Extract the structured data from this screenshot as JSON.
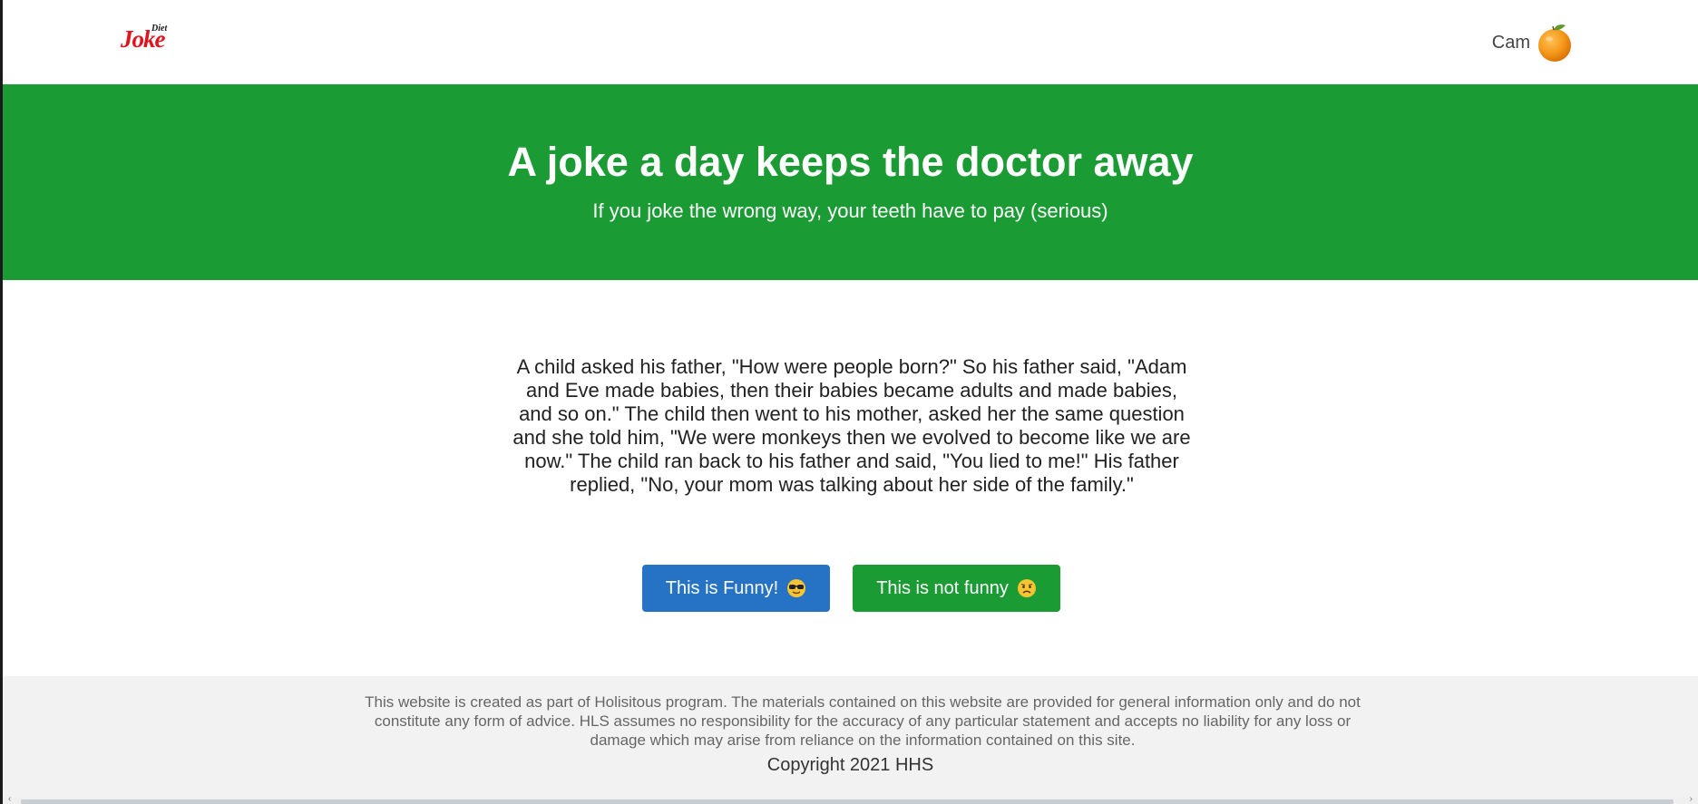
{
  "header": {
    "logo_small": "Diet",
    "logo_big": "Joke",
    "user_name": "Cam"
  },
  "hero": {
    "title": "A joke a day keeps the doctor away",
    "subtitle": "If you joke the wrong way, your teeth have to pay (serious)"
  },
  "joke": {
    "text": "A child asked his father, \"How were people born?\" So his father said, \"Adam and Eve made babies, then their babies became adults and made babies, and so on.\" The child then went to his mother, asked her the same question and she told him, \"We were monkeys then we evolved to become like we are now.\" The child ran back to his father and said, \"You lied to me!\" His father replied, \"No, your mom was talking about her side of the family.\""
  },
  "buttons": {
    "funny_label": "This is Funny!",
    "not_funny_label": "This is not funny",
    "funny_icon": "sunglasses-emoji-icon",
    "not_funny_icon": "sad-emoji-icon"
  },
  "footer": {
    "disclaimer": "This website is created as part of Holisitous program. The materials contained on this website are provided for general information only and do not constitute any form of advice. HLS assumes no responsibility for the accuracy of any particular statement and accepts no liability for any loss or damage which may arise from reliance on the information contained on this site.",
    "copyright": "Copyright 2021 HHS"
  },
  "colors": {
    "brand_green": "#1a9b33",
    "button_blue": "#2673c6",
    "logo_red": "#e1141e",
    "footer_bg": "#f2f2f2"
  }
}
